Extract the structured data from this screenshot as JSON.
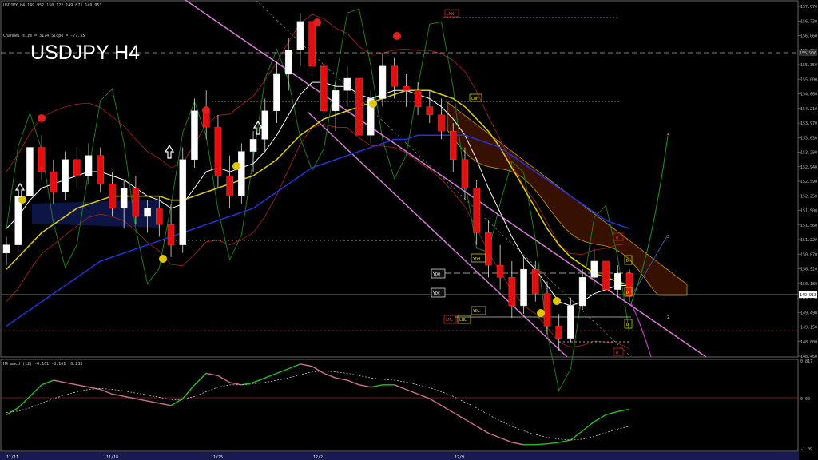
{
  "chart_data": {
    "type": "candlestick",
    "symbol_big": "USDJPY H4",
    "header": "USDJPY,H4  149.952 150.122 149.871 149.953",
    "channel_info": "Channel size = 3174 Slope = -77.55",
    "price_axis": {
      "ylim": [
        148.46,
        157.07
      ],
      "ticks": [
        "157.070",
        "156.730",
        "156.060",
        "155.690",
        "155.350",
        "155.000",
        "154.660",
        "154.210",
        "153.970",
        "153.630",
        "153.290",
        "152.940",
        "152.590",
        "152.250",
        "151.900",
        "151.560",
        "151.220",
        "150.870",
        "150.520",
        "150.180",
        "149.830",
        "149.490",
        "149.150",
        "148.800",
        "148.460"
      ],
      "current": "149.953",
      "reference": "155.906"
    },
    "x_labels": [
      "11/11",
      "11/18",
      "11/25",
      "12/2",
      "12/9"
    ],
    "indicator": {
      "title": "H4  macd (12)  -0.161  -0.161  -0.233",
      "ticks": [
        "0.817",
        "0.00",
        "-1.09"
      ],
      "ylim": [
        -1.09,
        0.817
      ]
    },
    "box_labels": {
      "lmh": "LMH",
      "lwh": "LWH",
      "ydh": "YDH",
      "ydo": "YDO",
      "ydc": "YDC",
      "ydl": "YDL",
      "lml": "LML",
      "lwl": "LWL",
      "w_top": "W",
      "w_bot": "W",
      "d1": "D",
      "d2": "D",
      "d3": "D"
    },
    "wave_labels": [
      "4",
      "3",
      "2"
    ],
    "candles": [
      [
        151.0,
        151.4,
        150.7,
        151.2
      ],
      [
        151.2,
        152.6,
        151.0,
        152.4
      ],
      [
        152.4,
        153.8,
        152.1,
        153.6
      ],
      [
        153.6,
        153.9,
        152.8,
        153.0
      ],
      [
        153.0,
        153.3,
        152.2,
        152.5
      ],
      [
        152.5,
        153.5,
        152.3,
        153.3
      ],
      [
        153.3,
        153.6,
        152.6,
        152.9
      ],
      [
        152.9,
        153.7,
        152.7,
        153.4
      ],
      [
        153.4,
        153.6,
        152.5,
        152.7
      ],
      [
        152.7,
        153.0,
        151.9,
        152.1
      ],
      [
        152.1,
        152.8,
        151.6,
        152.6
      ],
      [
        152.6,
        152.9,
        151.7,
        151.9
      ],
      [
        151.9,
        152.3,
        151.5,
        152.1
      ],
      [
        152.1,
        152.4,
        151.4,
        151.7
      ],
      [
        151.7,
        152.2,
        150.9,
        151.2
      ],
      [
        151.2,
        153.6,
        151.0,
        153.3
      ],
      [
        153.3,
        154.8,
        153.1,
        154.5
      ],
      [
        154.5,
        155.0,
        153.8,
        154.1
      ],
      [
        154.1,
        154.4,
        152.6,
        152.9
      ],
      [
        152.9,
        153.4,
        152.1,
        152.4
      ],
      [
        152.4,
        153.7,
        152.2,
        153.5
      ],
      [
        153.5,
        154.0,
        153.0,
        153.8
      ],
      [
        153.8,
        154.8,
        153.5,
        154.5
      ],
      [
        154.5,
        155.7,
        154.2,
        155.4
      ],
      [
        155.4,
        156.3,
        155.0,
        156.0
      ],
      [
        156.0,
        156.9,
        155.6,
        156.7
      ],
      [
        156.7,
        156.8,
        155.4,
        155.6
      ],
      [
        155.6,
        155.9,
        154.2,
        154.5
      ],
      [
        154.5,
        155.2,
        154.0,
        155.0
      ],
      [
        155.0,
        155.6,
        154.6,
        155.3
      ],
      [
        155.3,
        155.6,
        153.6,
        153.9
      ],
      [
        153.9,
        155.0,
        153.7,
        154.8
      ],
      [
        154.8,
        155.9,
        154.6,
        155.6
      ],
      [
        155.6,
        155.8,
        154.8,
        155.1
      ],
      [
        155.1,
        155.4,
        154.6,
        155.0
      ],
      [
        155.0,
        155.2,
        154.4,
        154.6
      ],
      [
        154.6,
        155.0,
        154.2,
        154.4
      ],
      [
        154.4,
        154.8,
        153.8,
        154.0
      ],
      [
        154.0,
        154.2,
        153.0,
        153.3
      ],
      [
        153.3,
        153.6,
        152.3,
        152.6
      ],
      [
        152.6,
        152.8,
        151.2,
        151.5
      ],
      [
        151.5,
        151.8,
        150.4,
        150.7
      ],
      [
        150.7,
        151.2,
        150.1,
        150.4
      ],
      [
        150.4,
        150.8,
        149.4,
        149.7
      ],
      [
        149.7,
        150.9,
        149.5,
        150.6
      ],
      [
        150.6,
        150.8,
        149.8,
        150.0
      ],
      [
        150.0,
        150.3,
        149.0,
        149.2
      ],
      [
        149.2,
        149.5,
        148.6,
        148.9
      ],
      [
        148.9,
        149.9,
        148.8,
        149.7
      ],
      [
        149.7,
        150.6,
        149.6,
        150.4
      ],
      [
        150.4,
        151.1,
        150.2,
        150.8
      ],
      [
        150.8,
        151.0,
        149.8,
        150.1
      ],
      [
        150.1,
        150.7,
        149.9,
        150.5
      ],
      [
        150.5,
        150.6,
        149.8,
        149.95
      ]
    ],
    "series": [
      {
        "name": "",
        "color": "#ffffff",
        "values": [
          151.6,
          151.9,
          152.3,
          152.6,
          152.7,
          152.8,
          152.9,
          153.0,
          153.0,
          152.9,
          152.8,
          152.6,
          152.4,
          152.3,
          152.1,
          152.2,
          152.6,
          153.0,
          153.1,
          153.0,
          153.1,
          153.2,
          153.5,
          153.9,
          154.4,
          154.9,
          155.2,
          155.2,
          155.1,
          155.1,
          154.9,
          154.8,
          154.9,
          155.0,
          155.0,
          154.9,
          154.8,
          154.6,
          154.3,
          153.9,
          153.3,
          152.6,
          152.0,
          151.4,
          150.9,
          150.6,
          150.2,
          149.8,
          149.7,
          149.8,
          150.0,
          150.1,
          150.2,
          150.2
        ]
      },
      {
        "name": "",
        "color": "#e0d000",
        "values": [
          150.6,
          150.9,
          151.2,
          151.5,
          151.7,
          151.9,
          152.1,
          152.2,
          152.3,
          152.4,
          152.4,
          152.4,
          152.4,
          152.4,
          152.3,
          152.3,
          152.4,
          152.5,
          152.6,
          152.7,
          152.8,
          152.9,
          153.1,
          153.3,
          153.6,
          153.9,
          154.1,
          154.3,
          154.4,
          154.5,
          154.6,
          154.7,
          154.8,
          154.9,
          155.0,
          155.0,
          155.0,
          154.9,
          154.8,
          154.6,
          154.3,
          154.0,
          153.6,
          153.1,
          152.6,
          152.1,
          151.6,
          151.2,
          150.9,
          150.7,
          150.5,
          150.4,
          150.3,
          150.2
        ]
      },
      {
        "name": "",
        "color": "#2234e0",
        "values": [
          149.2,
          149.4,
          149.6,
          149.8,
          150.0,
          150.2,
          150.4,
          150.6,
          150.8,
          150.9,
          151.0,
          151.1,
          151.2,
          151.3,
          151.4,
          151.5,
          151.6,
          151.7,
          151.8,
          151.9,
          152.0,
          152.1,
          152.3,
          152.5,
          152.7,
          152.9,
          153.1,
          153.2,
          153.3,
          153.4,
          153.5,
          153.6,
          153.7,
          153.8,
          153.8,
          153.9,
          153.9,
          153.9,
          153.9,
          153.9,
          153.8,
          153.7,
          153.6,
          153.4,
          153.2,
          153.0,
          152.8,
          152.6,
          152.4,
          152.2,
          152.0,
          151.8,
          151.7,
          151.6
        ]
      }
    ],
    "macd": {
      "main": [
        -0.35,
        -0.2,
        0.05,
        0.3,
        0.4,
        0.35,
        0.3,
        0.25,
        0.2,
        0.1,
        0.05,
        0.0,
        -0.05,
        -0.1,
        -0.15,
        0.0,
        0.3,
        0.55,
        0.5,
        0.35,
        0.3,
        0.35,
        0.45,
        0.55,
        0.65,
        0.75,
        0.7,
        0.55,
        0.45,
        0.4,
        0.3,
        0.25,
        0.3,
        0.3,
        0.2,
        0.1,
        0.0,
        -0.15,
        -0.3,
        -0.45,
        -0.6,
        -0.75,
        -0.85,
        -0.95,
        -1.0,
        -1.0,
        -0.98,
        -0.95,
        -0.9,
        -0.7,
        -0.5,
        -0.35,
        -0.28,
        -0.23
      ],
      "signal": [
        -0.3,
        -0.27,
        -0.2,
        -0.1,
        0.0,
        0.08,
        0.15,
        0.2,
        0.22,
        0.2,
        0.17,
        0.12,
        0.08,
        0.03,
        -0.02,
        -0.02,
        0.05,
        0.15,
        0.25,
        0.3,
        0.3,
        0.32,
        0.35,
        0.4,
        0.45,
        0.52,
        0.58,
        0.6,
        0.58,
        0.55,
        0.5,
        0.45,
        0.42,
        0.4,
        0.36,
        0.3,
        0.24,
        0.15,
        0.05,
        -0.08,
        -0.2,
        -0.35,
        -0.48,
        -0.6,
        -0.7,
        -0.78,
        -0.84,
        -0.88,
        -0.9,
        -0.88,
        -0.82,
        -0.74,
        -0.66,
        -0.6
      ]
    }
  }
}
